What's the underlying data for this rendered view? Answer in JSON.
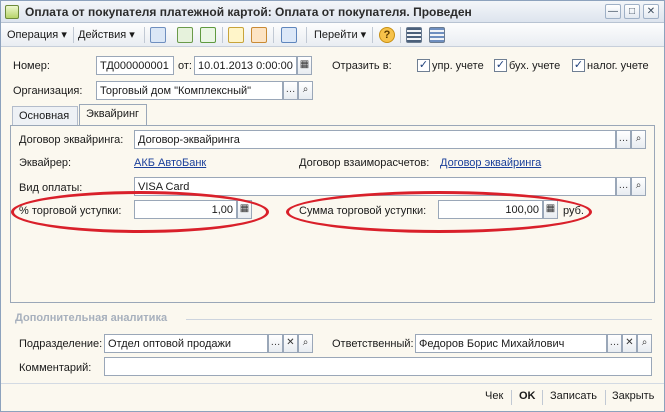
{
  "window": {
    "title": "Оплата от покупателя платежной картой: Оплата от покупателя. Проведен",
    "controls": {
      "minimize": "—",
      "maximize": "□",
      "close": "✕"
    }
  },
  "toolbar": {
    "operation_label": "Операция ▾",
    "actions_label": "Действия ▾",
    "goto_label": "Перейти ▾",
    "help_label": "?"
  },
  "header": {
    "number_label": "Номер:",
    "number_value": "ТД000000001",
    "from_label": "от:",
    "date_value": "10.01.2013  0:00:00",
    "reflect_label": "Отразить в:",
    "checks": [
      {
        "label": "упр. учете",
        "checked": true
      },
      {
        "label": "бух. учете",
        "checked": true
      },
      {
        "label": "налог. учете",
        "checked": true
      }
    ],
    "org_label": "Организация:",
    "org_value": "Торговый дом \"Комплексный\""
  },
  "tabs": [
    {
      "label": "Основная",
      "active": false
    },
    {
      "label": "Эквайринг",
      "active": true
    }
  ],
  "acquiring": {
    "contract_label": "Договор эквайринга:",
    "contract_value": "Договор-эквайринга",
    "acquirer_label": "Эквайрер:",
    "acquirer_value": "АКБ АвтоБанк",
    "settlement_label": "Договор взаиморасчетов:",
    "settlement_value": "Договор эквайринга",
    "payment_type_label": "Вид оплаты:",
    "payment_type_value": "VISA Card",
    "discount_pct_label": "% торговой уступки:",
    "discount_pct_value": "1,00",
    "discount_sum_label": "Сумма торговой уступки:",
    "discount_sum_value": "100,00",
    "currency": "руб."
  },
  "analytics": {
    "section_title": "Дополнительная аналитика",
    "dept_label": "Подразделение:",
    "dept_value": "Отдел оптовой продажи",
    "resp_label": "Ответственный:",
    "resp_value": "Федоров Борис Михайлович",
    "comment_label": "Комментарий:",
    "comment_value": ""
  },
  "footer": {
    "check_label": "Чек",
    "ok_label": "OK",
    "save_label": "Записать",
    "close_label": "Закрыть"
  },
  "colors": {
    "highlight": "#d9202a",
    "link": "#1a3f9a",
    "section": "#a7b0bd"
  }
}
